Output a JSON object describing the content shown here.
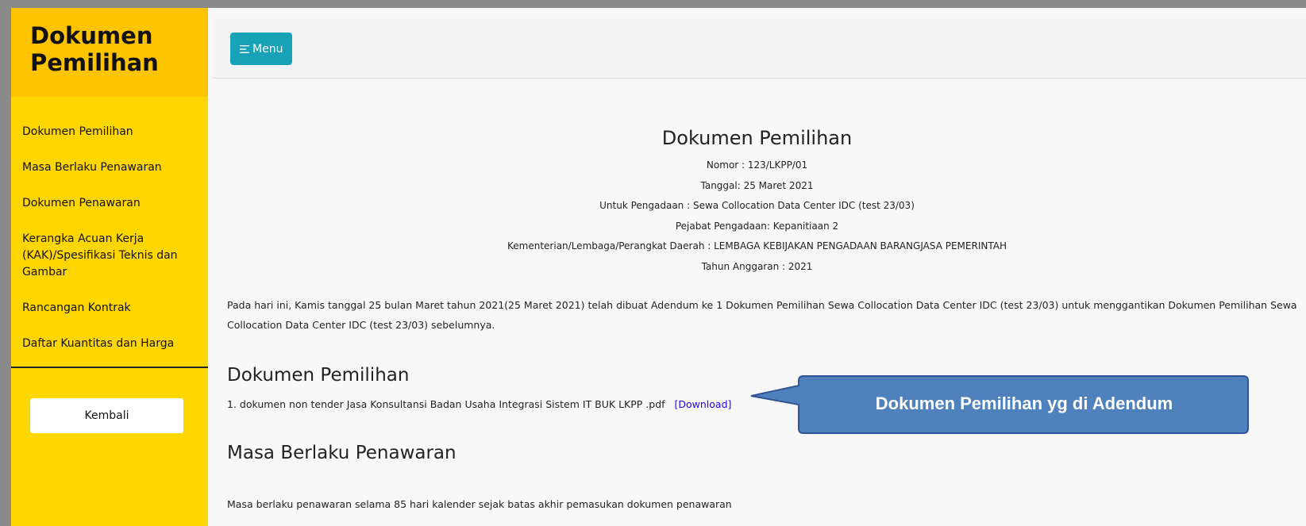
{
  "sidebar": {
    "title": "Dokumen Pemilihan",
    "items": [
      {
        "label": "Dokumen Pemilihan"
      },
      {
        "label": "Masa Berlaku Penawaran"
      },
      {
        "label": "Dokumen Penawaran"
      },
      {
        "label": "Kerangka Acuan Kerja (KAK)/Spesifikasi Teknis dan Gambar"
      },
      {
        "label": "Rancangan Kontrak"
      },
      {
        "label": "Daftar Kuantitas dan Harga"
      }
    ],
    "back_label": "Kembali"
  },
  "topbar": {
    "menu_label": "Menu",
    "menu_icon": "hamburger-icon"
  },
  "document": {
    "title": "Dokumen Pemilihan",
    "nomor": "Nomor : 123/LKPP/01",
    "tanggal": "Tanggal: 25 Maret 2021",
    "pengadaan": "Untuk Pengadaan : Sewa Collocation Data Center IDC (test 23/03)",
    "pejabat": "Pejabat Pengadaan: Kepanitiaan 2",
    "kementerian": "Kementerian/Lembaga/Perangkat Daerah : LEMBAGA KEBIJAKAN PENGADAAN BARANGJASA PEMERINTAH",
    "tahun": "Tahun Anggaran : 2021",
    "paragraph": "Pada hari ini, Kamis tanggal 25 bulan Maret tahun 2021(25 Maret 2021) telah dibuat Adendum ke 1 Dokumen Pemilihan Sewa Collocation Data Center IDC (test 23/03) untuk menggantikan Dokumen Pemilihan Sewa Collocation Data Center IDC (test 23/03) sebelumnya."
  },
  "section_dokumen": {
    "heading": "Dokumen Pemilihan",
    "file_text": "1. dokumen non tender Jasa Konsultansi Badan Usaha Integrasi Sistem IT BUK LKPP .pdf",
    "download_label": "[Download]"
  },
  "section_masa": {
    "heading": "Masa Berlaku Penawaran",
    "text": "Masa berlaku penawaran selama 85 hari kalender sejak batas akhir pemasukan dokumen penawaran"
  },
  "callout": {
    "text": "Dokumen Pemilihan yg di Adendum"
  },
  "colors": {
    "sidebar": "#ffd600",
    "sidebar_header": "#ffc400",
    "menu_button": "#17a2b8",
    "callout": "#4f81bd",
    "link": "#2200ff"
  }
}
